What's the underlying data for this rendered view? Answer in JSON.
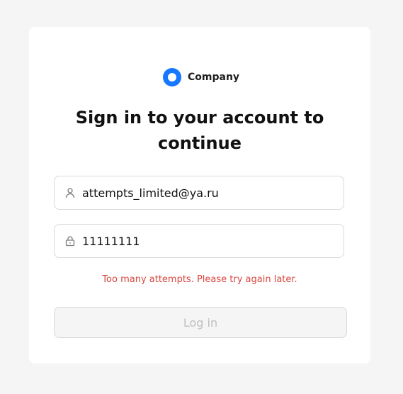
{
  "brand": {
    "name": "Company",
    "logo_icon": "ring-logo-icon",
    "logo_color": "#1677ff"
  },
  "heading": {
    "line1": "Sign in to your account to",
    "line2": "continue"
  },
  "form": {
    "email": {
      "value": "attempts_limited@ya.ru",
      "icon": "user-icon"
    },
    "password": {
      "value": "11111111",
      "icon": "lock-icon"
    },
    "error_message": "Too many attempts. Please try again later.",
    "error_color": "#d9463f",
    "submit_label": "Log in",
    "submit_disabled": true
  }
}
